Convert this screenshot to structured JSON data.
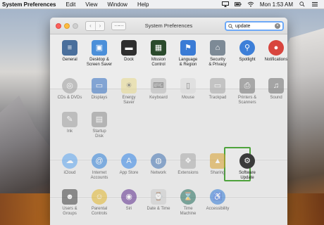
{
  "menubar": {
    "app_name": "System Preferences",
    "items": [
      "Edit",
      "View",
      "Window",
      "Help"
    ],
    "clock": "Mon 1:53 AM"
  },
  "window": {
    "title": "System Preferences",
    "search": {
      "value": "update"
    }
  },
  "panes": [
    {
      "label": "General",
      "icon": "general-icon",
      "color": "#4a6f9c"
    },
    {
      "label": "Desktop &\nScreen Saver",
      "icon": "desktop-icon",
      "color": "#4b8fd9"
    },
    {
      "label": "Dock",
      "icon": "dock-icon",
      "color": "#2f2f2f"
    },
    {
      "label": "Mission\nControl",
      "icon": "mission-control-icon",
      "color": "#2b4a2c"
    },
    {
      "label": "Language\n& Region",
      "icon": "flag-icon",
      "color": "#3a7bd5"
    },
    {
      "label": "Security\n& Privacy",
      "icon": "house-lock-icon",
      "color": "#7d8a96"
    },
    {
      "label": "Spotlight",
      "icon": "spotlight-icon",
      "color": "#3d7fd8"
    },
    {
      "label": "Notifications",
      "icon": "notifications-icon",
      "color": "#d8453e"
    },
    {
      "label": "CDs & DVDs",
      "icon": "disc-icon",
      "color": "#9c9c9c"
    },
    {
      "label": "Displays",
      "icon": "display-icon",
      "color": "#2d6bbf"
    },
    {
      "label": "Energy\nSaver",
      "icon": "bulb-icon",
      "color": "#e7d98a"
    },
    {
      "label": "Keyboard",
      "icon": "keyboard-icon",
      "color": "#b7b7b7"
    },
    {
      "label": "Mouse",
      "icon": "mouse-icon",
      "color": "#d7d7d7"
    },
    {
      "label": "Trackpad",
      "icon": "trackpad-icon",
      "color": "#a3a3a3"
    },
    {
      "label": "Printers &\nScanners",
      "icon": "printer-icon",
      "color": "#6f6f6f"
    },
    {
      "label": "Sound",
      "icon": "speaker-icon",
      "color": "#6a6a6a"
    },
    {
      "label": "Ink",
      "icon": "ink-icon",
      "color": "#9d9d9d"
    },
    {
      "label": "Startup\nDisk",
      "icon": "disk-icon",
      "color": "#8d8d8d"
    },
    {
      "label": "iCloud",
      "icon": "cloud-icon",
      "color": "#5aa3f0"
    },
    {
      "label": "Internet\nAccounts",
      "icon": "at-icon",
      "color": "#2a7ed8"
    },
    {
      "label": "App Store",
      "icon": "appstore-icon",
      "color": "#2b82e6"
    },
    {
      "label": "Network",
      "icon": "globe-icon",
      "color": "#3c6fb0"
    },
    {
      "label": "Extensions",
      "icon": "puzzle-icon",
      "color": "#a8a8a8"
    },
    {
      "label": "Sharing",
      "icon": "sharing-icon",
      "color": "#d9a12c"
    },
    {
      "label": "Software\nUpdate",
      "icon": "gear-icon",
      "color": "#3a3a3a"
    },
    {
      "label": "Users &\nGroups",
      "icon": "users-icon",
      "color": "#3c3c3c"
    },
    {
      "label": "Parental\nControls",
      "icon": "parental-icon",
      "color": "#e2b62a"
    },
    {
      "label": "Siri",
      "icon": "siri-icon",
      "color": "#5b2a8c"
    },
    {
      "label": "Date & Time",
      "icon": "calendar-clock-icon",
      "color": "#c9c9c9"
    },
    {
      "label": "Time\nMachine",
      "icon": "time-machine-icon",
      "color": "#1f6b5a"
    },
    {
      "label": "Accessibility",
      "icon": "accessibility-icon",
      "color": "#2c78d6"
    }
  ]
}
